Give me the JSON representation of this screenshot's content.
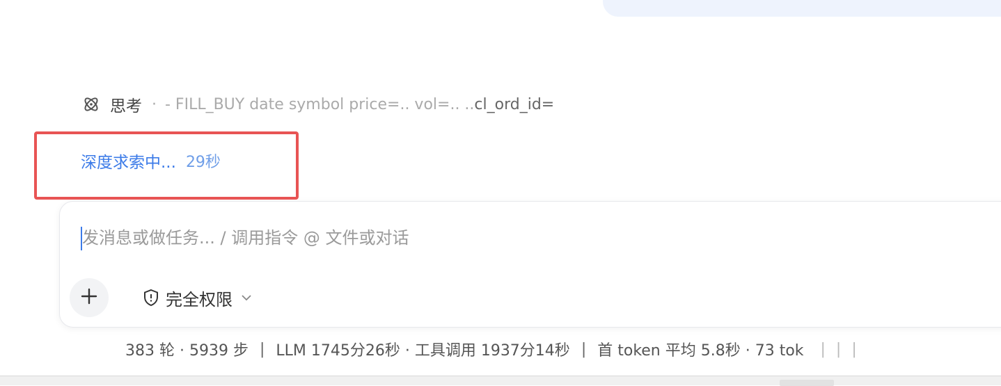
{
  "thinking": {
    "label": "思考",
    "separator": "·",
    "summary_prefix": "- FILL_BUY date symbol price=.. vol=.. ..",
    "summary_strong": "cl_ord_id="
  },
  "deep_search": {
    "label": "深度求索中...",
    "elapsed": "29秒"
  },
  "composer": {
    "placeholder": "发消息或做任务... / 调用指令 @ 文件或对话",
    "add_label": "+",
    "permission_label": "完全权限"
  },
  "stats": {
    "rounds_steps": "383 轮 · 5939 步",
    "llm_tools": "LLM 1745分26秒 · 工具调用 1937分14秒",
    "first_token": "首 token 平均 5.8秒 · 73 tok"
  },
  "colors": {
    "accent": "#3c7be8",
    "highlight": "#e85454",
    "user_bubble": "#eef3fd"
  },
  "icons": [
    "atom-icon",
    "plus-icon",
    "shield-alert-icon",
    "chevron-down-icon"
  ]
}
